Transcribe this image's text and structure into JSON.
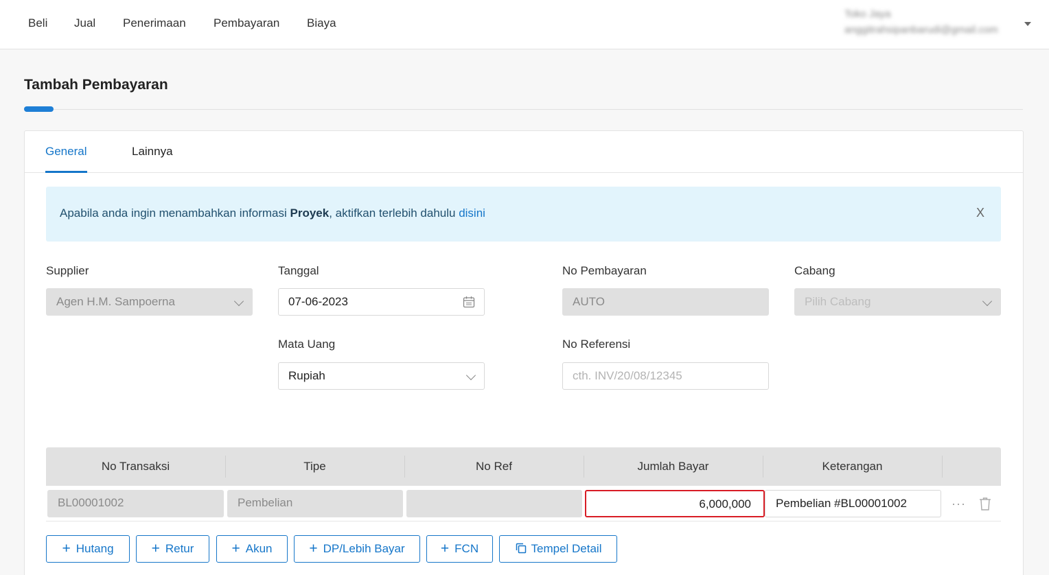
{
  "topnav": {
    "items": [
      "Beli",
      "Jual",
      "Penerimaan",
      "Pembayaran",
      "Biaya"
    ],
    "user_name": "Toko Jaya",
    "user_email": "anggitrahsipanbarudi@gmail.com"
  },
  "page": {
    "title": "Tambah Pembayaran",
    "accent_color": "#1e7fd6"
  },
  "tabs": [
    "General",
    "Lainnya"
  ],
  "alert": {
    "text_before": "Apabila anda ingin menambahkan informasi ",
    "bold": "Proyek",
    "text_after": ", aktifkan terlebih dahulu ",
    "link": "disini",
    "close": "X"
  },
  "form": {
    "supplier": {
      "label": "Supplier",
      "value": "Agen H.M. Sampoerna"
    },
    "tanggal": {
      "label": "Tanggal",
      "value": "07-06-2023"
    },
    "no_pembayaran": {
      "label": "No Pembayaran",
      "value": "AUTO"
    },
    "cabang": {
      "label": "Cabang",
      "placeholder": "Pilih Cabang"
    },
    "mata_uang": {
      "label": "Mata Uang",
      "value": "Rupiah"
    },
    "no_referensi": {
      "label": "No Referensi",
      "placeholder": "cth. INV/20/08/12345"
    }
  },
  "table": {
    "columns": [
      "No Transaksi",
      "Tipe",
      "No Ref",
      "Jumlah Bayar",
      "Keterangan"
    ],
    "rows": [
      {
        "no_transaksi": "BL00001002",
        "tipe": "Pembelian",
        "no_ref": "",
        "jumlah_bayar": "6,000,000",
        "keterangan": "Pembelian #BL00001002"
      }
    ],
    "more_glyph": "···"
  },
  "buttons": {
    "hutang": "Hutang",
    "retur": "Retur",
    "akun": "Akun",
    "dp": "DP/Lebih Bayar",
    "fcn": "FCN",
    "tempel": "Tempel Detail"
  },
  "colors": {
    "primary": "#1576c9",
    "highlight": "#d81c25",
    "alert_bg": "#e2f4fc"
  }
}
